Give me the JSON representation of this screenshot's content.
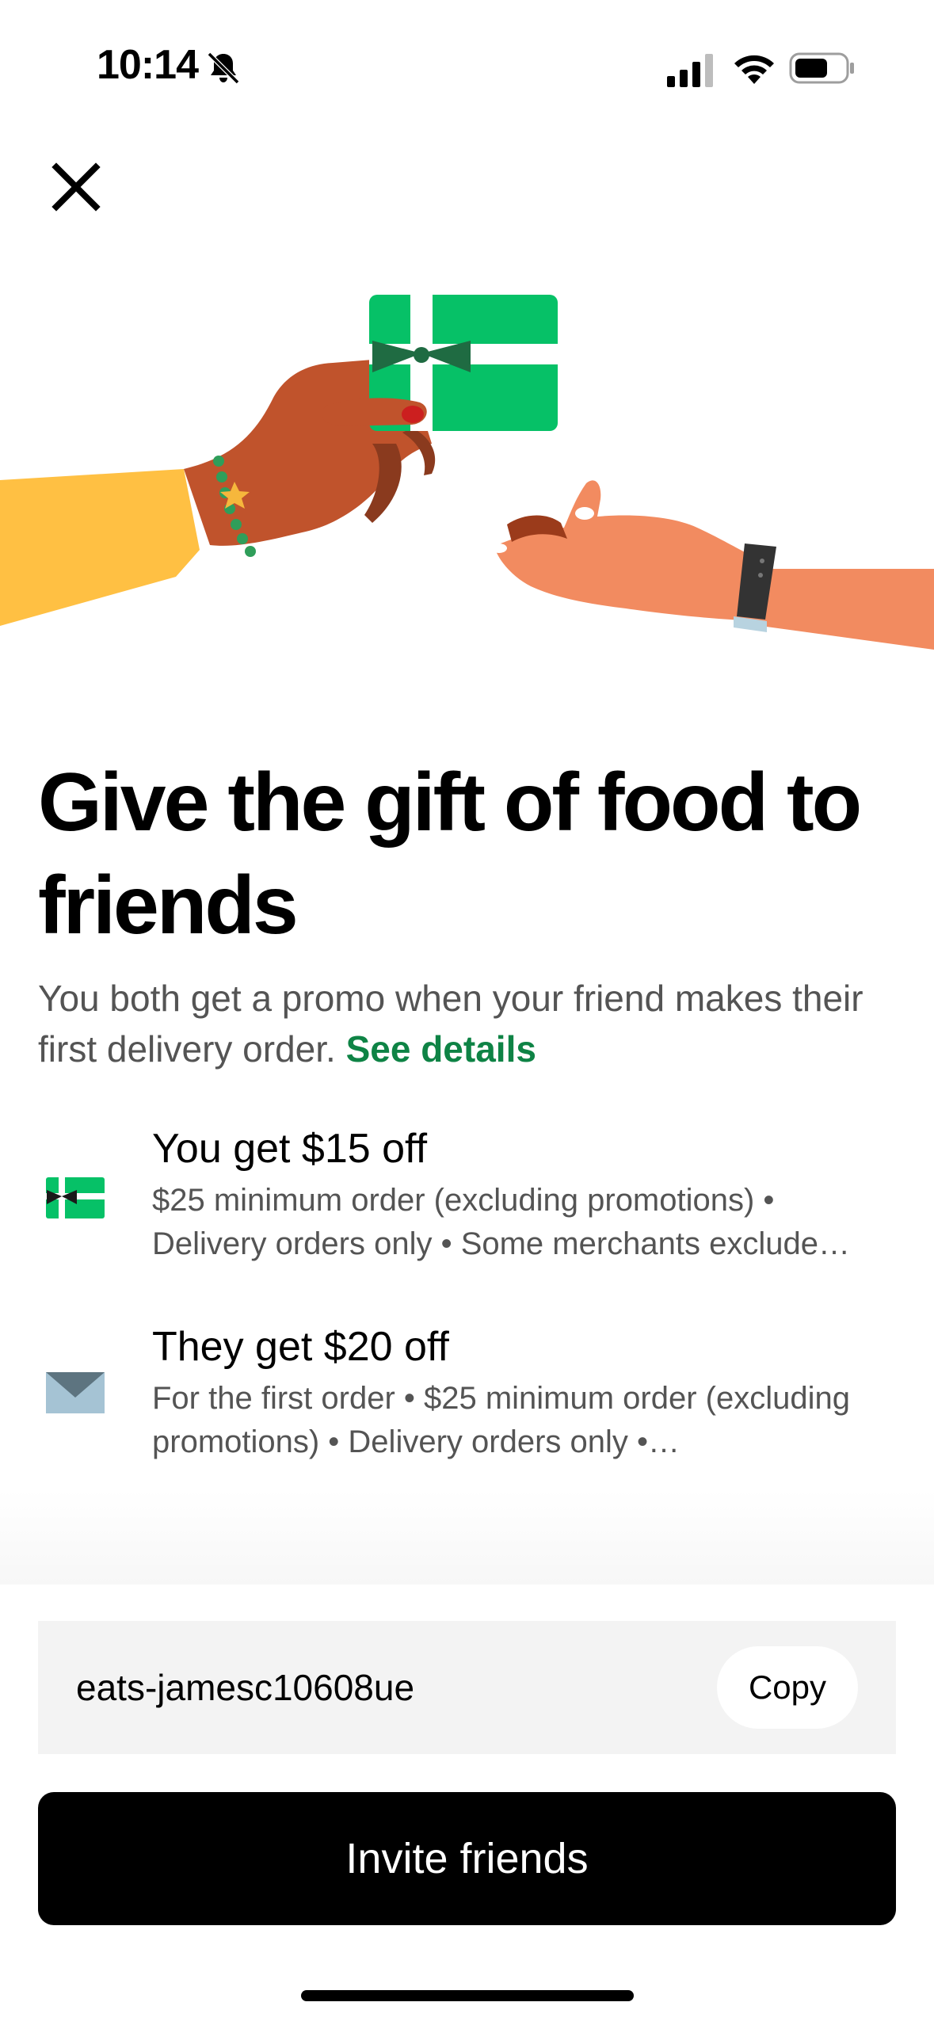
{
  "status_bar": {
    "time": "10:14",
    "icons": [
      "bell-slash-icon",
      "cellular-signal-icon",
      "wifi-icon",
      "battery-icon"
    ]
  },
  "header": {
    "close_icon": "close-icon"
  },
  "hero": {
    "illustration": "gift-card-handoff-illustration"
  },
  "headline": "Give the gift of food to friends",
  "subtext": {
    "body": "You both get a promo when your friend makes their first delivery order.",
    "link": "See details"
  },
  "perks": [
    {
      "icon": "gift-card-icon",
      "title": "You get $15 off",
      "description": "$25 minimum order (excluding promotions) • Delivery orders only • Some merchants exclude…"
    },
    {
      "icon": "envelope-icon",
      "title": "They get $20 off",
      "description": "For the first order • $25 minimum order (excluding promotions) • Delivery orders only •…"
    }
  ],
  "referral": {
    "code": "eats-jamesc10608ue",
    "copy_label": "Copy"
  },
  "invite_label": "Invite friends",
  "colors": {
    "accent_green": "#0e8345",
    "gift_green": "#06c167",
    "button_black": "#000000"
  }
}
